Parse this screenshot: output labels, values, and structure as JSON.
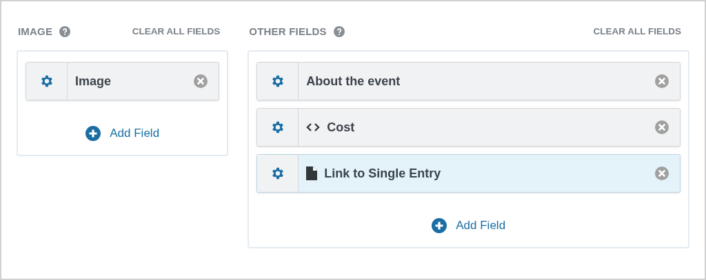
{
  "sections": [
    {
      "title": "IMAGE",
      "clear_label": "CLEAR ALL FIELDS",
      "add_label": "Add Field",
      "fields": [
        {
          "label": "Image",
          "kind": "plain",
          "highlighted": false
        }
      ]
    },
    {
      "title": "OTHER FIELDS",
      "clear_label": "CLEAR ALL FIELDS",
      "add_label": "Add Field",
      "fields": [
        {
          "label": "About the event",
          "kind": "plain",
          "highlighted": false
        },
        {
          "label": "Cost",
          "kind": "code",
          "highlighted": false
        },
        {
          "label": "Link to Single Entry",
          "kind": "file",
          "highlighted": true
        }
      ]
    }
  ]
}
